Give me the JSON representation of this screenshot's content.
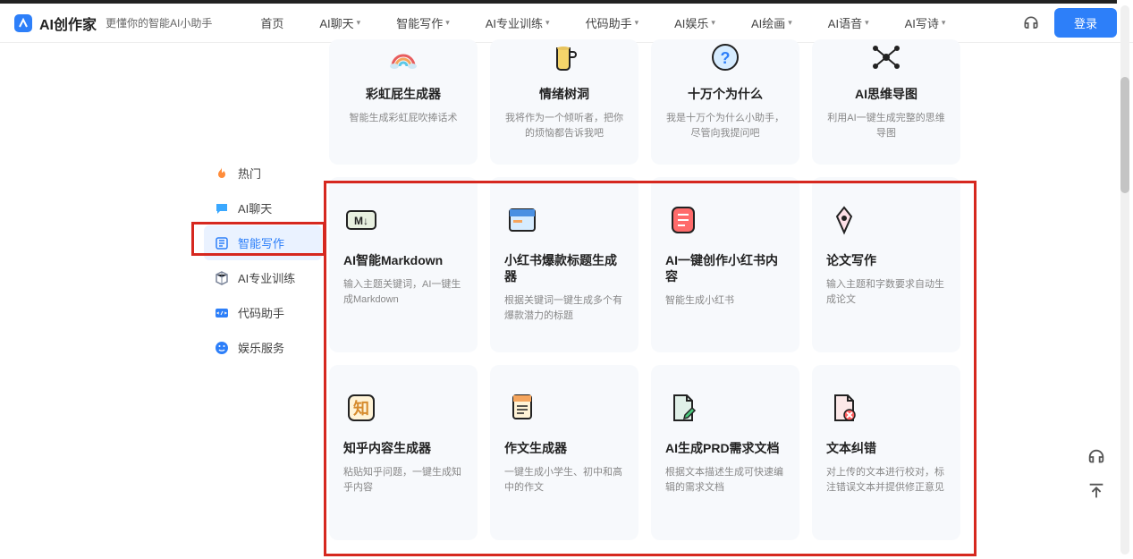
{
  "header": {
    "logo_text": "AI创作家",
    "slogan": "更懂你的智能AI小助手",
    "nav": [
      {
        "label": "首页",
        "dropdown": false
      },
      {
        "label": "AI聊天",
        "dropdown": true
      },
      {
        "label": "智能写作",
        "dropdown": true
      },
      {
        "label": "AI专业训练",
        "dropdown": true
      },
      {
        "label": "代码助手",
        "dropdown": true
      },
      {
        "label": "AI娱乐",
        "dropdown": true
      },
      {
        "label": "AI绘画",
        "dropdown": true
      },
      {
        "label": "AI语音",
        "dropdown": true
      },
      {
        "label": "AI写诗",
        "dropdown": true
      }
    ],
    "login": "登录"
  },
  "sidebar": [
    {
      "icon": "fire",
      "label": "热门",
      "color": "#ff8c3a"
    },
    {
      "icon": "chat",
      "label": "AI聊天",
      "color": "#3aa8ff"
    },
    {
      "icon": "edit",
      "label": "智能写作",
      "color": "#2d7ff9",
      "active": true
    },
    {
      "icon": "cube",
      "label": "AI专业训练",
      "color": "#7a8499"
    },
    {
      "icon": "code",
      "label": "代码助手",
      "color": "#2d7ff9"
    },
    {
      "icon": "smile",
      "label": "娱乐服务",
      "color": "#2d7ff9"
    }
  ],
  "cards_top": [
    {
      "title": "彩虹屁生成器",
      "desc": "智能生成彩虹屁吹捧话术"
    },
    {
      "title": "情绪树洞",
      "desc": "我将作为一个倾听者，把你的烦恼都告诉我吧"
    },
    {
      "title": "十万个为什么",
      "desc": "我是十万个为什么小助手，尽管向我提问吧"
    },
    {
      "title": "AI思维导图",
      "desc": "利用AI一键生成完整的思维导图"
    }
  ],
  "cards_row2": [
    {
      "title": "AI智能Markdown",
      "desc": "输入主题关键词，AI一键生成Markdown"
    },
    {
      "title": "小红书爆款标题生成器",
      "desc": "根据关键词一键生成多个有爆款潜力的标题"
    },
    {
      "title": "AI一键创作小红书内容",
      "desc": "智能生成小红书"
    },
    {
      "title": "论文写作",
      "desc": "输入主题和字数要求自动生成论文"
    }
  ],
  "cards_row3": [
    {
      "title": "知乎内容生成器",
      "desc": "粘贴知乎问题，一键生成知乎内容"
    },
    {
      "title": "作文生成器",
      "desc": "一键生成小学生、初中和高中的作文"
    },
    {
      "title": "AI生成PRD需求文档",
      "desc": "根据文本描述生成可快速编辑的需求文档"
    },
    {
      "title": "文本纠错",
      "desc": "对上传的文本进行校对，标注错误文本并提供修正意见"
    }
  ]
}
